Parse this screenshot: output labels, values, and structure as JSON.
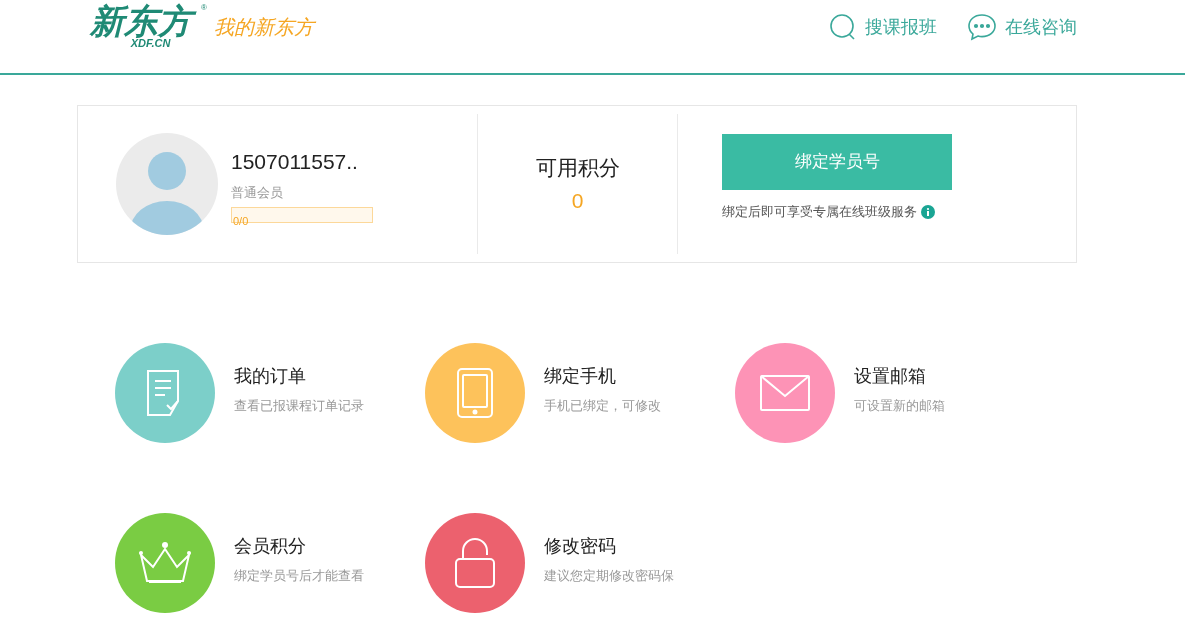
{
  "header": {
    "logo_main": "新东方",
    "logo_sub": "XDF.CN",
    "logo_mark": "®",
    "site_name": "我的新东方",
    "nav": [
      {
        "kind": "search",
        "label": "搜课报班"
      },
      {
        "kind": "chat",
        "label": "在线咨询"
      }
    ]
  },
  "profile": {
    "username": "1507011557..",
    "member_level": "普通会员",
    "progress": {
      "text": "0/0",
      "level": 0
    }
  },
  "points": {
    "label": "可用积分",
    "value": "0"
  },
  "binding": {
    "button": "绑定学员号",
    "note": "绑定后即可享受专属在线班级服务"
  },
  "features": [
    {
      "kind": "order",
      "color": "#7ccfc9",
      "title": "我的订单",
      "desc": "查看已报课程订单记录"
    },
    {
      "kind": "phone",
      "color": "#fdc25b",
      "title": "绑定手机",
      "desc": "手机已绑定，可修改"
    },
    {
      "kind": "mail",
      "color": "#fd93b6",
      "title": "设置邮箱",
      "desc": "可设置新的邮箱"
    },
    {
      "kind": "crown",
      "color": "#7acc43",
      "title": "会员积分",
      "desc": "绑定学员号后才能查看"
    },
    {
      "kind": "lock",
      "color": "#ec616e",
      "title": "修改密码",
      "desc": "建议您定期修改密码保"
    }
  ]
}
